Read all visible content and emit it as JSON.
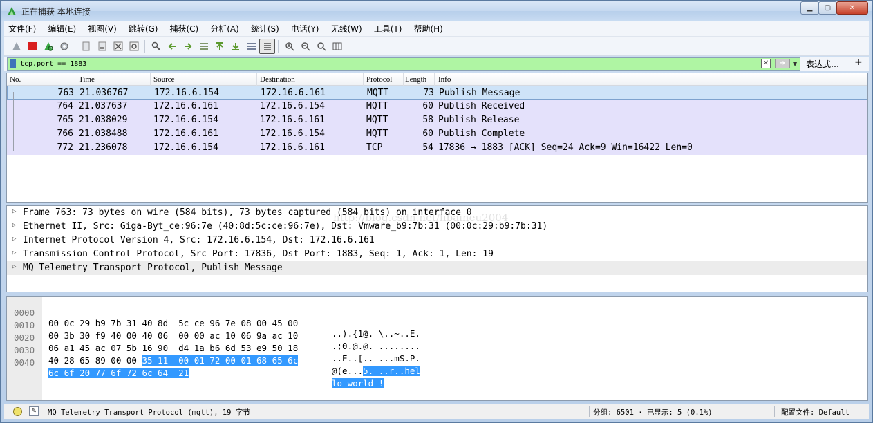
{
  "window": {
    "title": "正在捕获 本地连接",
    "buttons": [
      "minimize",
      "maximize",
      "close"
    ]
  },
  "menu": [
    "文件(F)",
    "编辑(E)",
    "视图(V)",
    "跳转(G)",
    "捕获(C)",
    "分析(A)",
    "统计(S)",
    "电话(Y)",
    "无线(W)",
    "工具(T)",
    "帮助(H)"
  ],
  "toolbar": {
    "icons": [
      "shark-fin-start-icon",
      "stop-icon",
      "restart-icon",
      "options-gear-icon",
      "open-file-icon",
      "save-icon",
      "close-file-icon",
      "reload-icon",
      "find-icon",
      "go-back-icon",
      "go-forward-icon",
      "go-to-packet-icon",
      "first-packet-icon",
      "last-packet-icon",
      "autoscroll-icon",
      "colorize-icon",
      "zoom-in-icon",
      "zoom-out-icon",
      "normal-size-icon",
      "resize-columns-icon"
    ]
  },
  "filter": {
    "value": "tcp.port == 1883",
    "expression_label": "表达式…",
    "add_label": "+"
  },
  "packet_list": {
    "columns": [
      "No.",
      "Time",
      "Source",
      "Destination",
      "Protocol",
      "Length",
      "Info"
    ],
    "rows": [
      {
        "no": "763",
        "time": "21.036767",
        "source": "172.16.6.154",
        "destination": "172.16.6.161",
        "protocol": "MQTT",
        "length": "73",
        "info": "Publish Message"
      },
      {
        "no": "764",
        "time": "21.037637",
        "source": "172.16.6.161",
        "destination": "172.16.6.154",
        "protocol": "MQTT",
        "length": "60",
        "info": "Publish Received"
      },
      {
        "no": "765",
        "time": "21.038029",
        "source": "172.16.6.154",
        "destination": "172.16.6.161",
        "protocol": "MQTT",
        "length": "58",
        "info": "Publish Release"
      },
      {
        "no": "766",
        "time": "21.038488",
        "source": "172.16.6.161",
        "destination": "172.16.6.154",
        "protocol": "MQTT",
        "length": "60",
        "info": "Publish Complete"
      },
      {
        "no": "772",
        "time": "21.236078",
        "source": "172.16.6.154",
        "destination": "172.16.6.161",
        "protocol": "TCP",
        "length": "54",
        "info": "17836 → 1883 [ACK] Seq=24 Ack=9 Win=16422 Len=0"
      }
    ]
  },
  "details": [
    "Frame 763: 73 bytes on wire (584 bits), 73 bytes captured (584 bits) on interface 0",
    "Ethernet II, Src: Giga-Byt_ce:96:7e (40:8d:5c:ce:96:7e), Dst: Vmware_b9:7b:31 (00:0c:29:b9:7b:31)",
    "Internet Protocol Version 4, Src: 172.16.6.154, Dst: 172.16.6.161",
    "Transmission Control Protocol, Src Port: 17836, Dst Port: 1883, Seq: 1, Ack: 1, Len: 19",
    "MQ Telemetry Transport Protocol, Publish Message"
  ],
  "watermark": "http://blog.csdn.net/libaineu2004",
  "bytes": [
    {
      "offset": "0000",
      "hex": "00 0c 29 b9 7b 31 40 8d  5c ce 96 7e 08 00 45 00",
      "hex_hl": "",
      "ascii": "..).{1@. \\..~..E.",
      "ascii_hl": ""
    },
    {
      "offset": "0010",
      "hex": "00 3b 30 f9 40 00 40 06  00 00 ac 10 06 9a ac 10",
      "hex_hl": "",
      "ascii": ".;0.@.@. ........",
      "ascii_hl": ""
    },
    {
      "offset": "0020",
      "hex": "06 a1 45 ac 07 5b 16 90  d4 1a b6 6d 53 e9 50 18",
      "hex_hl": "",
      "ascii": "..E..[.. ...mS.P.",
      "ascii_hl": ""
    },
    {
      "offset": "0030",
      "hex": "40 28 65 89 00 00 ",
      "hex_hl": "35 11  00 01 72 00 01 68 65 6c",
      "ascii": "@(e...",
      "ascii_hl": "5. ..r..hel"
    },
    {
      "offset": "0040",
      "hex": "",
      "hex_hl": "6c 6f 20 77 6f 72 6c 64  21",
      "ascii": "",
      "ascii_hl": "lo world !"
    }
  ],
  "status": {
    "protocol_text": "MQ Telemetry Transport Protocol (mqtt), 19 字节",
    "packets_text": "分组: 6501 · 已显示: 5 (0.1%)",
    "profile_text": "配置文件: Default"
  }
}
